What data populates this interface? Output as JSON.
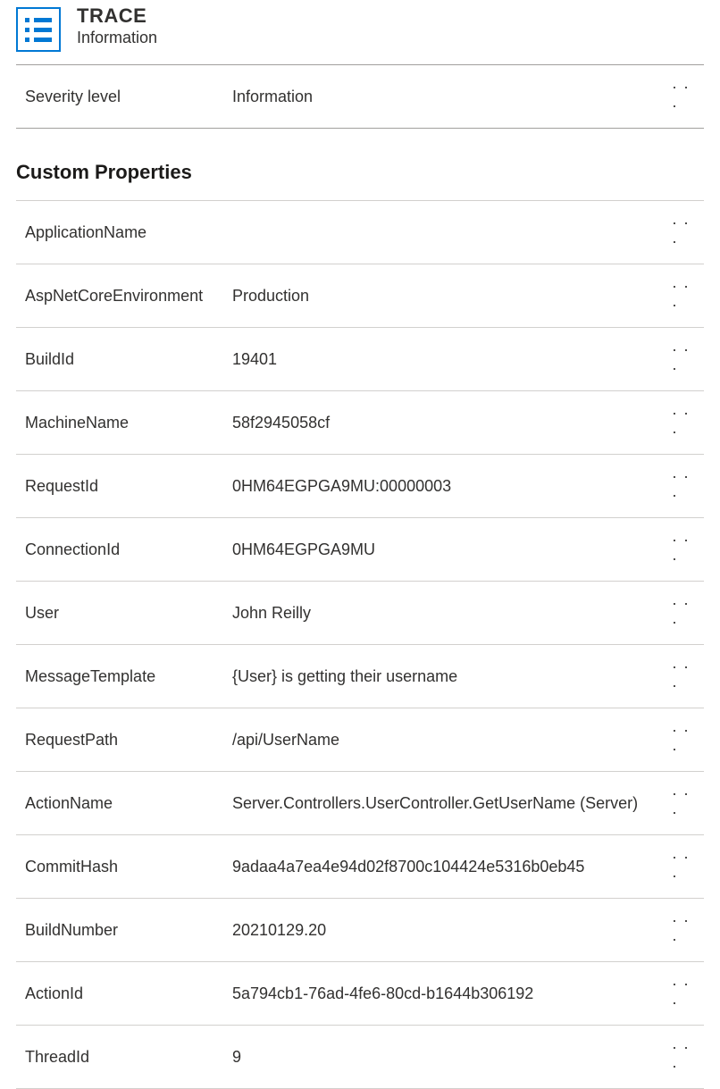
{
  "header": {
    "title": "TRACE",
    "subtitle": "Information"
  },
  "severity": {
    "label": "Severity level",
    "value": "Information"
  },
  "customProperties": {
    "title": "Custom Properties",
    "rows": [
      {
        "label": "ApplicationName",
        "value": ""
      },
      {
        "label": "AspNetCoreEnvironment",
        "value": "Production"
      },
      {
        "label": "BuildId",
        "value": "19401"
      },
      {
        "label": "MachineName",
        "value": "58f2945058cf"
      },
      {
        "label": "RequestId",
        "value": "0HM64EGPGA9MU:00000003"
      },
      {
        "label": "ConnectionId",
        "value": "0HM64EGPGA9MU"
      },
      {
        "label": "User",
        "value": "John Reilly"
      },
      {
        "label": "MessageTemplate",
        "value": "{User} is getting their username"
      },
      {
        "label": "RequestPath",
        "value": "/api/UserName"
      },
      {
        "label": "ActionName",
        "value": "Server.Controllers.UserController.GetUserName (Server)"
      },
      {
        "label": "CommitHash",
        "value": "9adaa4a7ea4e94d02f8700c104424e5316b0eb45"
      },
      {
        "label": "BuildNumber",
        "value": "20210129.20"
      },
      {
        "label": "ActionId",
        "value": "5a794cb1-76ad-4fe6-80cd-b1644b306192"
      },
      {
        "label": "ThreadId",
        "value": "9"
      }
    ]
  },
  "glyphs": {
    "ellipsis": "· · ·"
  }
}
